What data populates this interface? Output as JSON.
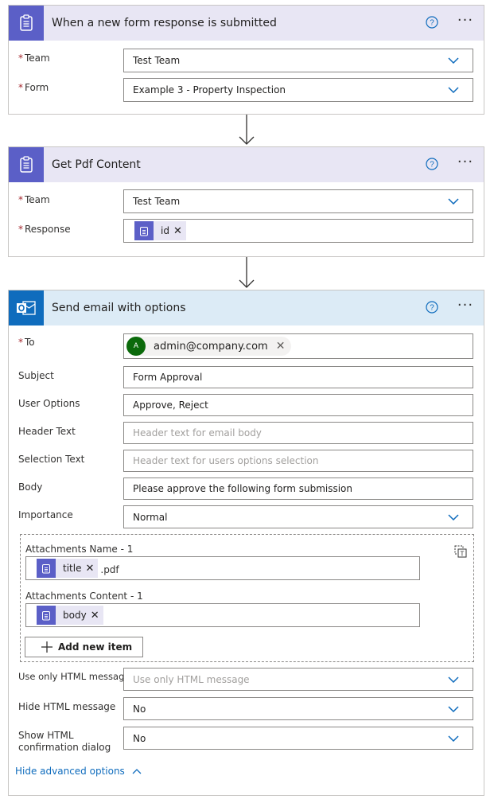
{
  "trigger": {
    "title": "When a new form response is submitted",
    "help_icon": "help-circle-icon",
    "more_icon": "ellipsis-icon",
    "more_text": "···",
    "fields": [
      {
        "label": "Team",
        "required_mark": "*",
        "value": "Test Team"
      },
      {
        "label": "Form",
        "required_mark": "*",
        "value": "Example 3 - Property Inspection"
      }
    ]
  },
  "get_pdf": {
    "title": "Get Pdf Content",
    "more_text": "···",
    "team": {
      "label": "Team",
      "required_mark": "*",
      "value": "Test Team"
    },
    "response": {
      "label": "Response",
      "required_mark": "*",
      "token_label": "id",
      "token_remove": "✕"
    }
  },
  "send_email": {
    "title": "Send email with options",
    "more_text": "···",
    "to": {
      "label": "To",
      "required_mark": "*",
      "avatar_initial": "A",
      "avatar_color": "#0b6a0b",
      "email": "admin@company.com",
      "remove": "✕"
    },
    "subject": {
      "label": "Subject",
      "value": "Form Approval"
    },
    "user_options": {
      "label": "User Options",
      "value": "Approve, Reject"
    },
    "header_text": {
      "label": "Header Text",
      "placeholder": "Header text for email body"
    },
    "selection_text": {
      "label": "Selection Text",
      "placeholder": "Header text for users options selection"
    },
    "body": {
      "label": "Body",
      "value": "Please approve the following form submission"
    },
    "importance": {
      "label": "Importance",
      "value": "Normal"
    },
    "attachments": {
      "name_label": "Attachments Name - 1",
      "name_token": "title",
      "name_suffix": ".pdf",
      "content_label": "Attachments Content - 1",
      "content_token": "body",
      "token_remove": "✕",
      "add_item_label": "Add new item",
      "switch_icon": "switch-to-text-mode-icon"
    },
    "use_only_html": {
      "label": "Use only HTML message",
      "placeholder": "Use only HTML message"
    },
    "hide_html": {
      "label": "Hide HTML message",
      "value": "No"
    },
    "show_html_confirm": {
      "label": "Show HTML confirmation dialog",
      "value": "No"
    },
    "hide_advanced_label": "Hide advanced options"
  },
  "colors": {
    "forms_purple": "#5b5fc7",
    "forms_header_bg": "#e8e6f4",
    "outlook_blue": "#0f6cbd",
    "outlook_header_bg": "#dcebf6",
    "required_red": "#a4262c"
  }
}
